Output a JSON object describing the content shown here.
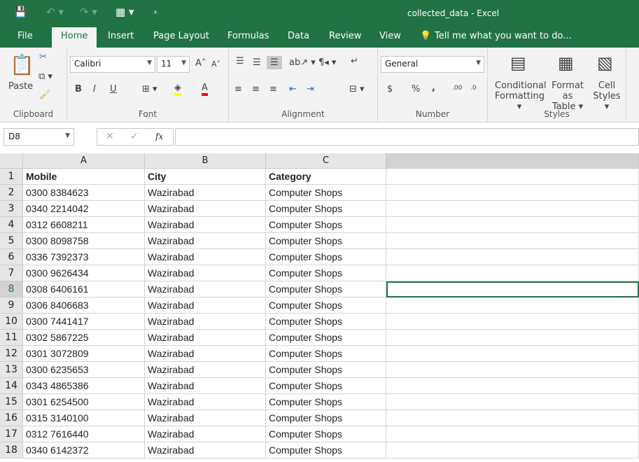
{
  "window": {
    "title": "collected_data - Excel"
  },
  "tabs": [
    "File",
    "Home",
    "Insert",
    "Page Layout",
    "Formulas",
    "Data",
    "Review",
    "View"
  ],
  "tell_me": "Tell me what you want to do...",
  "ribbon": {
    "clipboard": {
      "label": "Clipboard",
      "paste": "Paste"
    },
    "font": {
      "label": "Font",
      "name": "Calibri",
      "size": "11",
      "bold": "B",
      "italic": "I",
      "underline": "U",
      "highlight_color": "#ffff00",
      "font_color": "#ff0000"
    },
    "alignment": {
      "label": "Alignment"
    },
    "number": {
      "label": "Number",
      "format": "General",
      "currency": "$",
      "percent": "%",
      "comma": ","
    },
    "styles": {
      "label": "Styles",
      "conditional": "Conditional",
      "conditional2": "Formatting",
      "format_table": "Format as",
      "format_table2": "Table",
      "cell_styles": "Cell",
      "cell_styles2": "Styles"
    }
  },
  "formula_bar": {
    "name_box": "D8",
    "fx": "fx",
    "value": ""
  },
  "columns": [
    "A",
    "B",
    "C"
  ],
  "selected_cell": "D8",
  "rows": [
    [
      "Mobile",
      "City",
      "Category"
    ],
    [
      "0300 8384623",
      "Wazirabad",
      "Computer Shops"
    ],
    [
      "0340 2214042",
      "Wazirabad",
      "Computer Shops"
    ],
    [
      "0312 6608211",
      "Wazirabad",
      "Computer Shops"
    ],
    [
      "0300 8098758",
      "Wazirabad",
      "Computer Shops"
    ],
    [
      "0336 7392373",
      "Wazirabad",
      "Computer Shops"
    ],
    [
      "0300 9626434",
      "Wazirabad",
      "Computer Shops"
    ],
    [
      "0308 6406161",
      "Wazirabad",
      "Computer Shops"
    ],
    [
      "0306 8406683",
      "Wazirabad",
      "Computer Shops"
    ],
    [
      "0300 7441417",
      "Wazirabad",
      "Computer Shops"
    ],
    [
      "0302 5867225",
      "Wazirabad",
      "Computer Shops"
    ],
    [
      "0301 3072809",
      "Wazirabad",
      "Computer Shops"
    ],
    [
      "0300 6235653",
      "Wazirabad",
      "Computer Shops"
    ],
    [
      "0343 4865386",
      "Wazirabad",
      "Computer Shops"
    ],
    [
      "0301 6254500",
      "Wazirabad",
      "Computer Shops"
    ],
    [
      "0315 3140100",
      "Wazirabad",
      "Computer Shops"
    ],
    [
      "0312 7616440",
      "Wazirabad",
      "Computer Shops"
    ],
    [
      "0340 6142372",
      "Wazirabad",
      "Computer Shops"
    ]
  ]
}
